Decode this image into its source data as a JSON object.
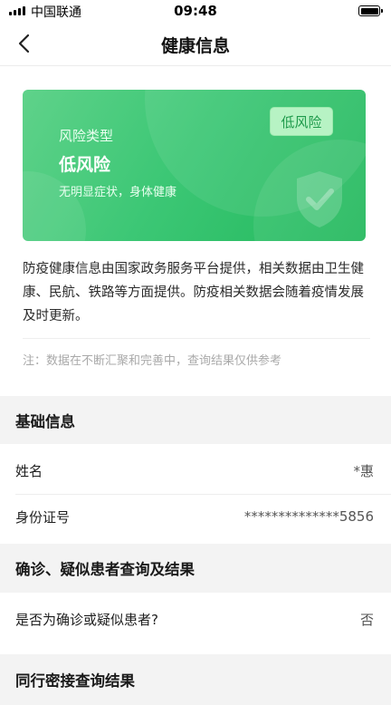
{
  "status_bar": {
    "carrier": "中国联通",
    "time": "09:48"
  },
  "nav": {
    "title": "健康信息"
  },
  "risk_card": {
    "label": "风险类型",
    "level": "低风险",
    "description": "无明显症状，身体健康",
    "badge": "低风险",
    "accent_color": "#3cc775"
  },
  "notice": {
    "text": "防疫健康信息由国家政务服务平台提供，相关数据由卫生健康、民航、铁路等方面提供。防疫相关数据会随着疫情发展及时更新。",
    "footnote": "注：数据在不断汇聚和完善中，查询结果仅供参考"
  },
  "basic_info": {
    "title": "基础信息",
    "rows": [
      {
        "label": "姓名",
        "value": "*惠"
      },
      {
        "label": "身份证号",
        "value": "**************5856"
      }
    ]
  },
  "diagnosis": {
    "title": "确诊、疑似患者查询及结果",
    "rows": [
      {
        "label": "是否为确诊或疑似患者?",
        "value": "否"
      }
    ]
  },
  "contact": {
    "title": "同行密接查询结果"
  }
}
